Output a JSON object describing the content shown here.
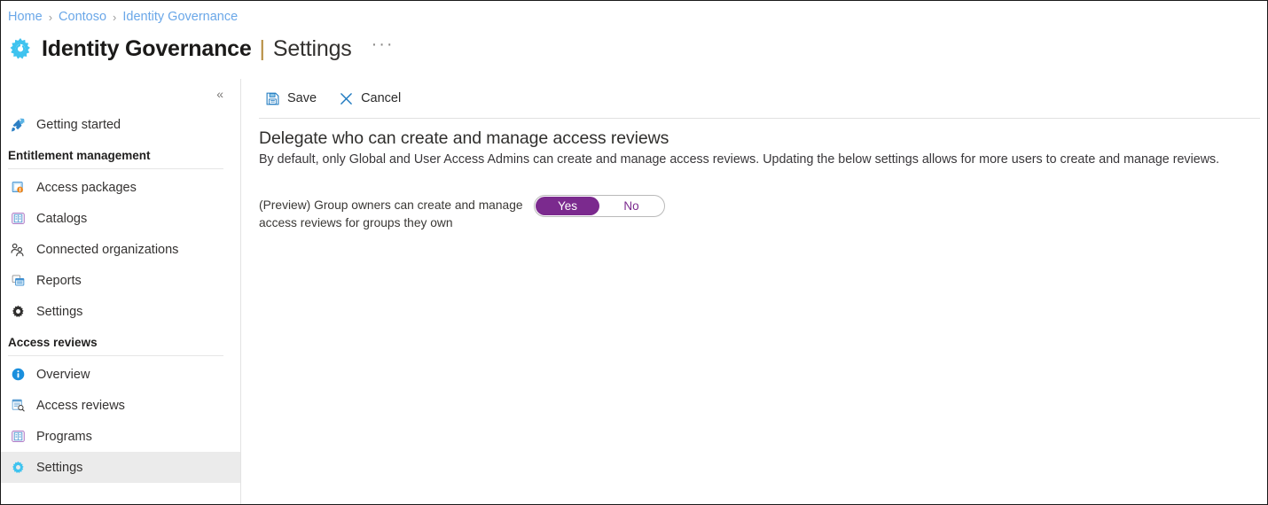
{
  "breadcrumb": {
    "items": [
      {
        "label": "Home"
      },
      {
        "label": "Contoso"
      },
      {
        "label": "Identity Governance"
      }
    ],
    "separator": "›"
  },
  "header": {
    "icon": "gear-icon",
    "title": "Identity Governance",
    "divider": "|",
    "subtitle": "Settings",
    "more_label": "···"
  },
  "sidebar": {
    "collapse_label": "«",
    "top_items": [
      {
        "label": "Getting started",
        "icon": "rocket-icon",
        "selected": false
      }
    ],
    "sections": [
      {
        "title": "Entitlement management",
        "items": [
          {
            "label": "Access packages",
            "icon": "package-icon",
            "selected": false
          },
          {
            "label": "Catalogs",
            "icon": "book-icon",
            "selected": false
          },
          {
            "label": "Connected organizations",
            "icon": "people-icon",
            "selected": false
          },
          {
            "label": "Reports",
            "icon": "report-icon",
            "selected": false
          },
          {
            "label": "Settings",
            "icon": "gear-dark-icon",
            "selected": false
          }
        ]
      },
      {
        "title": "Access reviews",
        "items": [
          {
            "label": "Overview",
            "icon": "info-icon",
            "selected": false
          },
          {
            "label": "Access reviews",
            "icon": "list-search-icon",
            "selected": false
          },
          {
            "label": "Programs",
            "icon": "book-icon",
            "selected": false
          },
          {
            "label": "Settings",
            "icon": "gear-icon",
            "selected": true
          }
        ]
      }
    ]
  },
  "toolbar": {
    "save_label": "Save",
    "cancel_label": "Cancel"
  },
  "main": {
    "heading": "Delegate who can create and manage access reviews",
    "description": "By default, only Global and User Access Admins can create and manage access reviews. Updating the below settings allows for more users to create and manage reviews.",
    "setting": {
      "label": "(Preview) Group owners can create and manage access reviews for groups they own",
      "options": [
        "Yes",
        "No"
      ],
      "selected": "Yes"
    }
  },
  "colors": {
    "breadcrumb_link": "#6aa7e8",
    "accent_cyan": "#3ec3ef",
    "toggle_purple": "#7b2a8e",
    "selected_row_bg": "#ebebeb",
    "command_blue": "#0078d4"
  }
}
